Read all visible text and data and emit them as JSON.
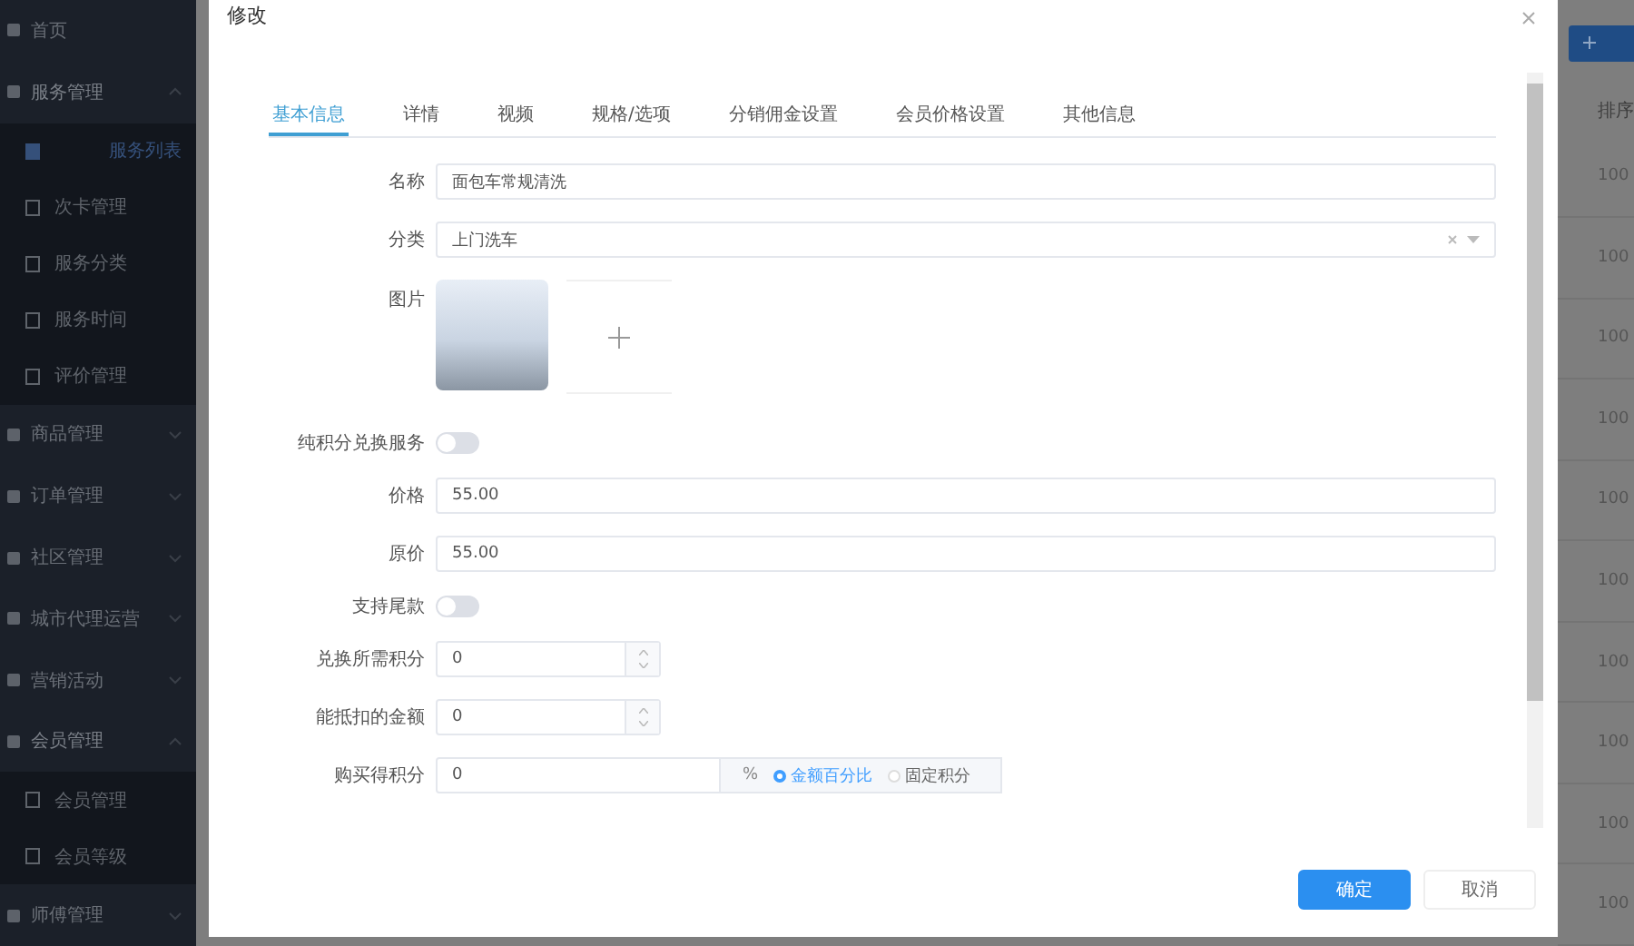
{
  "sidebar": {
    "items": [
      {
        "label": "首页",
        "kind": "link"
      },
      {
        "label": "服务管理",
        "kind": "submenu",
        "expanded": true,
        "children": [
          {
            "label": "服务列表",
            "selected": true
          },
          {
            "label": "次卡管理",
            "selected": false
          },
          {
            "label": "服务分类",
            "selected": false
          },
          {
            "label": "服务时间",
            "selected": false
          },
          {
            "label": "评价管理",
            "selected": false
          }
        ]
      },
      {
        "label": "商品管理",
        "kind": "submenu",
        "expanded": false
      },
      {
        "label": "订单管理",
        "kind": "submenu",
        "expanded": false
      },
      {
        "label": "社区管理",
        "kind": "submenu",
        "expanded": false
      },
      {
        "label": "城市代理运营",
        "kind": "submenu",
        "expanded": false
      },
      {
        "label": "营销活动",
        "kind": "submenu",
        "expanded": false
      },
      {
        "label": "会员管理",
        "kind": "submenu",
        "expanded": true,
        "children": [
          {
            "label": "会员管理",
            "selected": false
          },
          {
            "label": "会员等级",
            "selected": false
          }
        ]
      },
      {
        "label": "师傅管理",
        "kind": "submenu",
        "expanded": false
      }
    ]
  },
  "table": {
    "header": "排序",
    "cells": [
      "100",
      "100",
      "100",
      "100",
      "100",
      "100",
      "100",
      "100",
      "100",
      "100"
    ]
  },
  "modal": {
    "title": "修改",
    "tabs": [
      {
        "label": "基本信息",
        "selected": true
      },
      {
        "label": "详情",
        "selected": false
      },
      {
        "label": "视频",
        "selected": false
      },
      {
        "label": "规格/选项",
        "selected": false
      },
      {
        "label": "分销佣金设置",
        "selected": false
      },
      {
        "label": "会员价格设置",
        "selected": false
      },
      {
        "label": "其他信息",
        "selected": false
      }
    ],
    "rows": [
      {
        "kind": "text",
        "label": "名称",
        "value": "面包车常规清洗"
      },
      {
        "kind": "select",
        "label": "分类",
        "value": "上门洗车"
      },
      {
        "kind": "image",
        "label": "图片"
      },
      {
        "kind": "switch",
        "label": "纯积分兑换服务",
        "on": false
      },
      {
        "kind": "text",
        "label": "价格",
        "value": "55.00"
      },
      {
        "kind": "text",
        "label": "原价",
        "value": "55.00"
      },
      {
        "kind": "switch",
        "label": "支持尾款",
        "on": false
      },
      {
        "kind": "number",
        "label": "兑换所需积分",
        "value": "0"
      },
      {
        "kind": "number",
        "label": "能抵扣的金额",
        "value": "0"
      },
      {
        "kind": "addon",
        "label": "购买得积分",
        "value": "0",
        "unit": "%",
        "options": [
          {
            "label": "金额百分比",
            "selected": true
          },
          {
            "label": "固定积分",
            "selected": false
          }
        ]
      }
    ],
    "buttons": [
      {
        "label": "确定",
        "kind": "primary"
      },
      {
        "label": "取消",
        "kind": "default"
      }
    ]
  }
}
